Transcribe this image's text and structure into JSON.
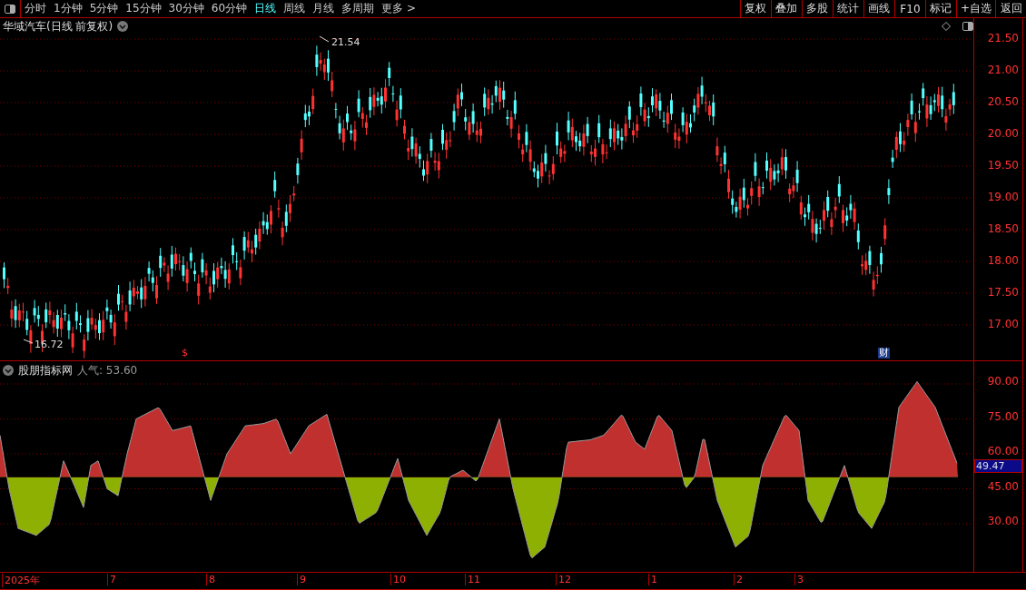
{
  "toolbar": {
    "periods": [
      {
        "label": "分时",
        "selected": false
      },
      {
        "label": "1分钟",
        "selected": false
      },
      {
        "label": "5分钟",
        "selected": false
      },
      {
        "label": "15分钟",
        "selected": false
      },
      {
        "label": "30分钟",
        "selected": false
      },
      {
        "label": "60分钟",
        "selected": false
      },
      {
        "label": "日线",
        "selected": true
      },
      {
        "label": "周线",
        "selected": false
      },
      {
        "label": "月线",
        "selected": false
      },
      {
        "label": "多周期",
        "selected": false
      },
      {
        "label": "更多 >",
        "selected": false
      }
    ],
    "buttons": [
      "复权",
      "叠加",
      "多股",
      "统计",
      "画线",
      "F10",
      "标记",
      "+自选",
      "返回"
    ]
  },
  "price_panel": {
    "title": "华域汽车(日线 前复权)",
    "high_label": "21.54",
    "low_label": "16.72",
    "markers": [
      "$",
      "财"
    ],
    "axis_labels": [
      "21.50",
      "21.00",
      "20.50",
      "20.00",
      "19.50",
      "19.00",
      "18.50",
      "18.00",
      "17.50",
      "17.00"
    ]
  },
  "indicator_panel": {
    "title": "股朋指标网",
    "reading": "人气: 53.60",
    "current_value": "49.47",
    "axis_labels": [
      "90.00",
      "75.00",
      "60.00",
      "45.00",
      "30.00"
    ]
  },
  "date_axis": [
    "2025年",
    "7",
    "8",
    "9",
    "10",
    "11",
    "12",
    "1",
    "2",
    "3"
  ]
}
